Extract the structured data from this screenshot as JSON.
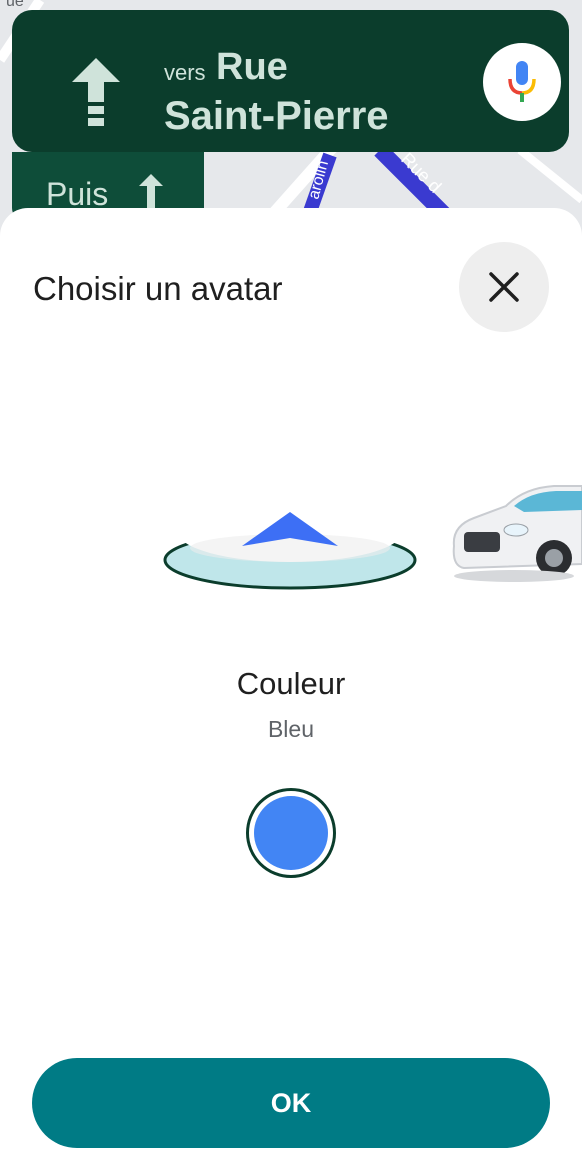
{
  "nav": {
    "direction_prefix": "vers",
    "street_line_1": "Rue",
    "street_line_2": "Saint-Pierre",
    "then_label": "Puis",
    "direction_icon": "straight-arrow-icon",
    "mic_icon": "microphone-icon"
  },
  "map": {
    "street_label_1": "arolin",
    "street_label_2": "Rue d",
    "corner_label": "ue"
  },
  "sheet": {
    "title": "Choisir un avatar",
    "close_icon": "close-icon",
    "avatars": [
      "navigation-arrow-avatar",
      "car-avatar"
    ],
    "color_title": "Couleur",
    "color_value": "Bleu",
    "swatch_color": "#4285f4",
    "ok_label": "OK"
  },
  "colors": {
    "banner": "#0b3d2c",
    "accent": "#007b85",
    "avatar_arrow": "#3d6ff5"
  }
}
